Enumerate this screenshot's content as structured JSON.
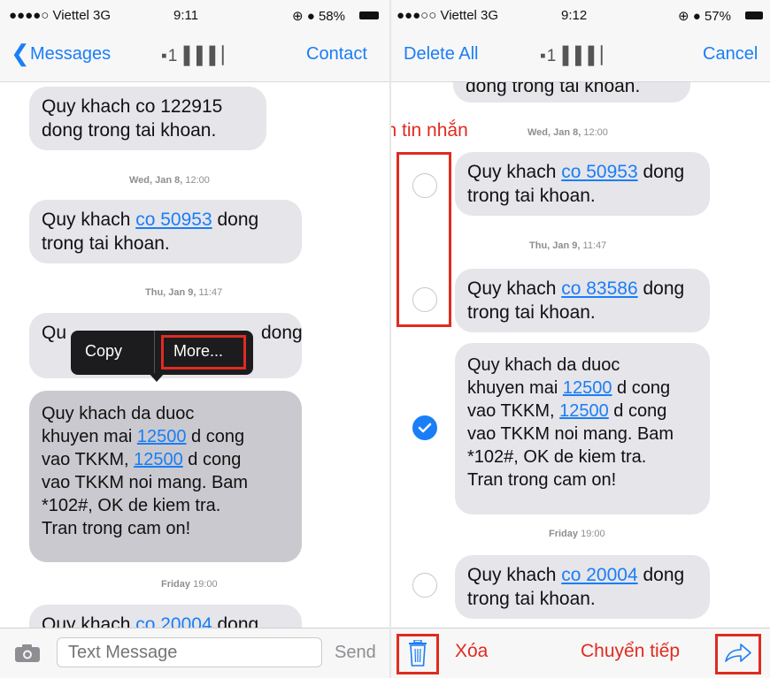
{
  "left": {
    "status": {
      "carrier": "●●●●○ Viettel 3G",
      "time": "9:11",
      "battery": "⊕ ● 58%"
    },
    "nav": {
      "back_label": "Messages",
      "title": "▪1 ▌▌▌▏",
      "contact_label": "Contact"
    },
    "messages": [
      {
        "pre": "Quy khach co 122915 dong trong tai khoan.",
        "link": "",
        "post": ""
      },
      {
        "pre": "Quy khach ",
        "link": "co 50953",
        "post": " dong trong tai khoan."
      },
      {
        "pre": "Qu",
        "link": "",
        "post": "dong"
      },
      {
        "lines": [
          "Quy khach da duoc",
          "khuyen mai ",
          "12500",
          " d cong",
          "vao TKKM, ",
          "12500",
          " d cong",
          "vao TKKM noi mang. Bam",
          "*102#, OK de kiem tra.",
          "Tran trong cam on!"
        ]
      },
      {
        "pre": "Quy khach ",
        "link": "co 20004",
        "post": " dong"
      }
    ],
    "timestamps": [
      {
        "day": "Wed, Jan 8,",
        "time": "12:00"
      },
      {
        "day": "Thu, Jan 9,",
        "time": "11:47"
      },
      {
        "day": "Friday",
        "time": "19:00"
      }
    ],
    "popup": {
      "copy": "Copy",
      "more": "More..."
    },
    "input": {
      "placeholder": "Text Message",
      "send": "Send"
    }
  },
  "right": {
    "status": {
      "carrier": "●●●○○ Viettel 3G",
      "time": "9:12",
      "battery": "⊕ ● 57%"
    },
    "nav": {
      "delete_all": "Delete All",
      "title": "▪1 ▌▌▌▏",
      "cancel": "Cancel"
    },
    "messages": [
      {
        "pre": "Quy khach ",
        "link": "co 50953",
        "post": " dong trong tai khoan."
      },
      {
        "pre": "Quy khach ",
        "link": "co 83586",
        "post": " dong trong tai khoan."
      },
      {
        "lines": [
          "Quy khach da duoc",
          "khuyen mai ",
          "12500",
          " d cong",
          "vao TKKM, ",
          "12500",
          " d cong",
          "vao TKKM noi mang. Bam",
          "*102#, OK de kiem tra.",
          "Tran trong cam on!"
        ]
      },
      {
        "pre": "Quy khach ",
        "link": "co 20004",
        "post": " dong trong tai khoan."
      }
    ],
    "cut_top": "dong trong tai khoan.",
    "timestamps": [
      {
        "day": "Wed, Jan 8,",
        "time": "12:00"
      },
      {
        "day": "Thu, Jan 9,",
        "time": "11:47"
      },
      {
        "day": "Friday",
        "time": "19:00"
      }
    ],
    "annotations": {
      "select": "Chọn tin nhắn",
      "delete": "Xóa",
      "forward": "Chuyển tiếp"
    }
  },
  "colors": {
    "accent": "#1a7ef6",
    "annotation": "#e02b20",
    "bubble": "#e5e5ea"
  }
}
